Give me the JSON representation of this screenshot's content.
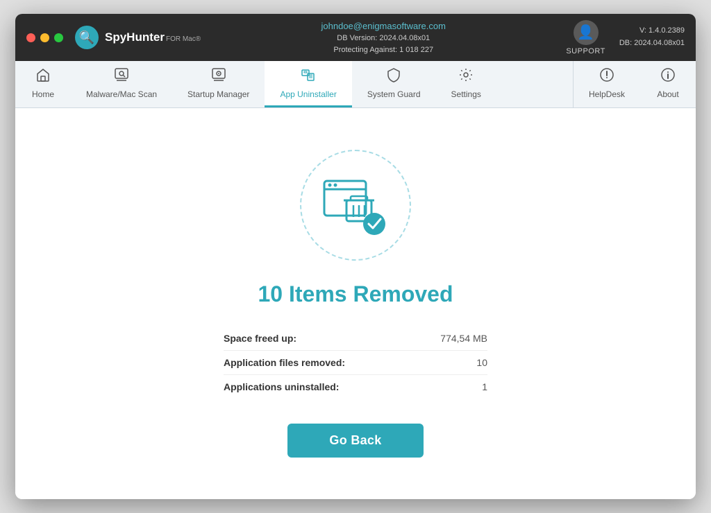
{
  "titlebar": {
    "brand_name": "SpyHunter",
    "brand_sub": "FOR Mac®",
    "user_icon": "👤",
    "email": "johndoe@enigmasoftware.com",
    "db_version_label": "DB Version: 2024.04.08x01",
    "protecting_label": "Protecting Against: 1 018 227",
    "support_label": "SUPPORT",
    "version": "V: 1.4.0.2389",
    "db_version": "DB:  2024.04.08x01"
  },
  "navbar": {
    "items": [
      {
        "id": "home",
        "label": "Home",
        "icon": "🏠",
        "active": false
      },
      {
        "id": "malware-scan",
        "label": "Malware/Mac Scan",
        "icon": "🔍",
        "active": false
      },
      {
        "id": "startup-manager",
        "label": "Startup Manager",
        "icon": "⚙",
        "active": false
      },
      {
        "id": "app-uninstaller",
        "label": "App Uninstaller",
        "icon": "🗂",
        "active": true
      },
      {
        "id": "system-guard",
        "label": "System Guard",
        "icon": "🛡",
        "active": false
      },
      {
        "id": "settings",
        "label": "Settings",
        "icon": "⚙",
        "active": false
      }
    ],
    "right_items": [
      {
        "id": "helpdesk",
        "label": "HelpDesk",
        "icon": "➕"
      },
      {
        "id": "about",
        "label": "About",
        "icon": "ℹ"
      }
    ]
  },
  "main": {
    "result_title": "10 Items Removed",
    "stats": [
      {
        "label": "Space freed up:",
        "value": "774,54 MB"
      },
      {
        "label": "Application files removed:",
        "value": "10"
      },
      {
        "label": "Applications uninstalled:",
        "value": "1"
      }
    ],
    "go_back_label": "Go Back"
  },
  "colors": {
    "accent": "#2ea8b8",
    "active_tab": "#2ea8b8"
  }
}
